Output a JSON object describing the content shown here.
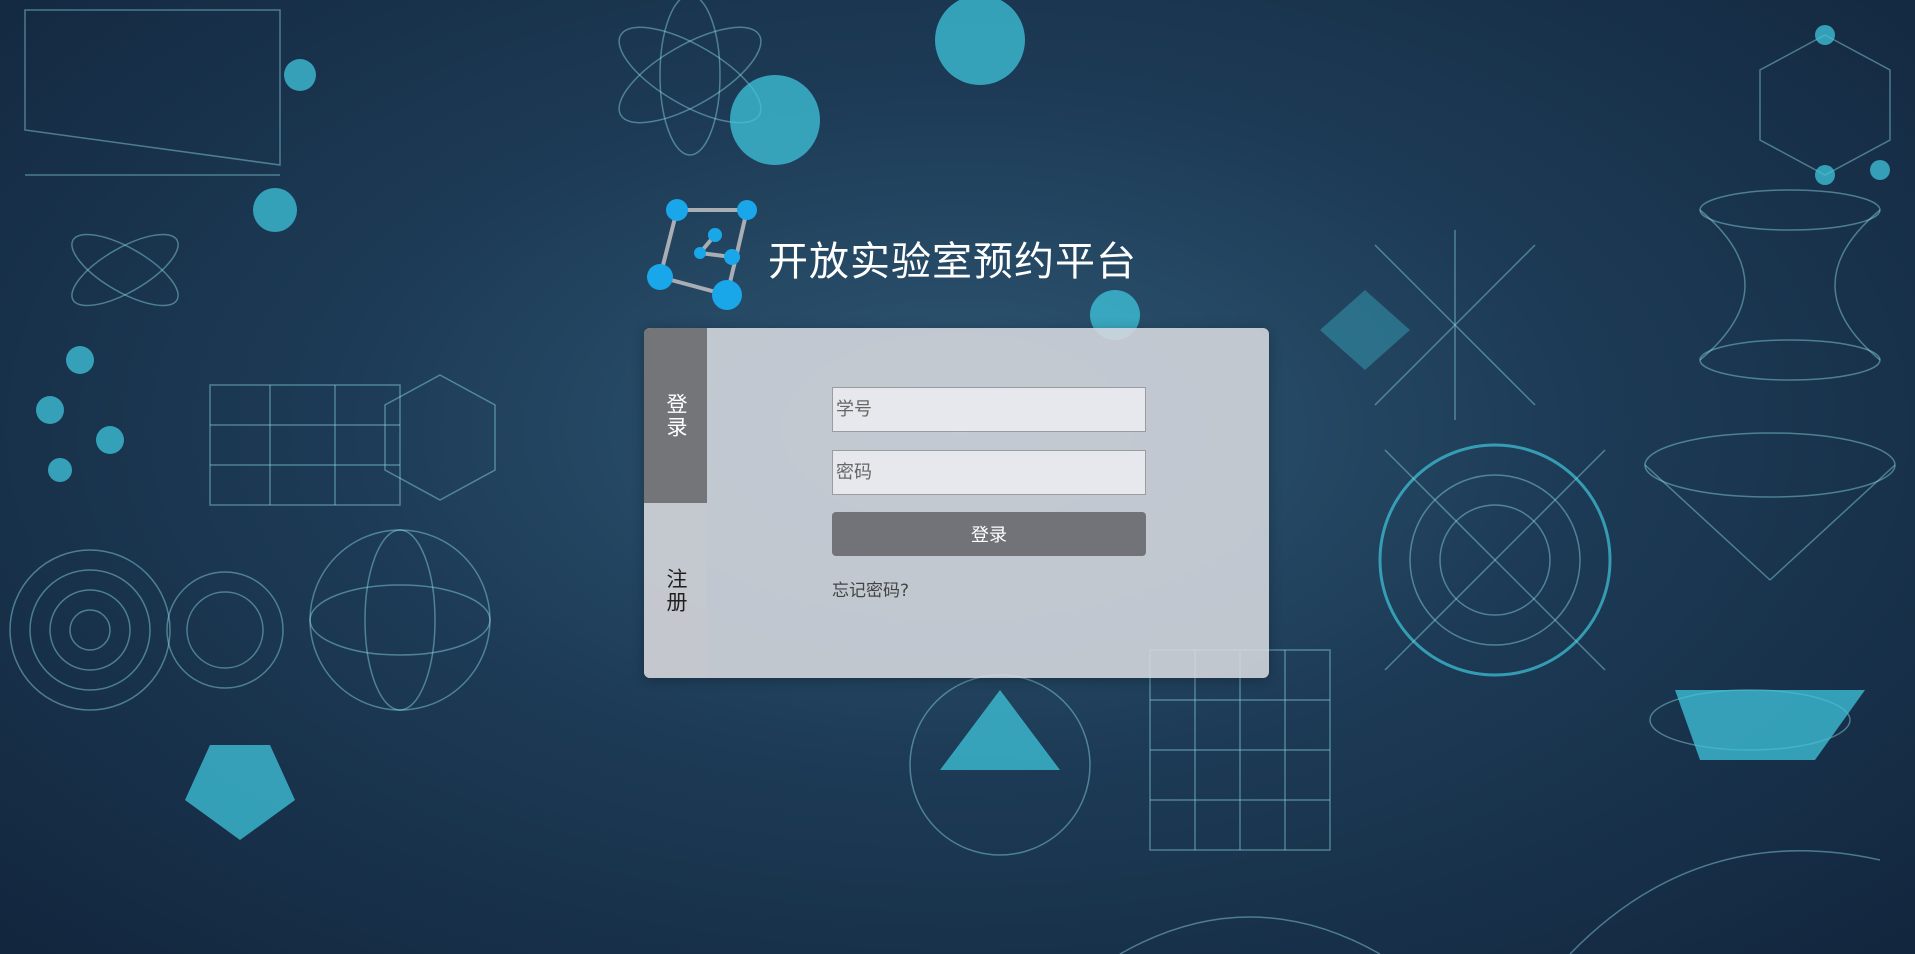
{
  "brand": {
    "title": "开放实验室预约平台",
    "logo_icon": "molecule-cube-icon",
    "accent_color": "#1aa7ea"
  },
  "tabs": [
    {
      "label": "登录",
      "active": true
    },
    {
      "label": "注册",
      "active": false
    }
  ],
  "login_form": {
    "student_id_placeholder": "学号",
    "student_id_value": "",
    "password_placeholder": "密码",
    "password_value": "",
    "submit_label": "登录",
    "forgot_password_label": "忘记密码?"
  },
  "background": {
    "theme": "science-illustrations",
    "base_color": "#1d3b56",
    "line_color": "#8fdce8"
  }
}
